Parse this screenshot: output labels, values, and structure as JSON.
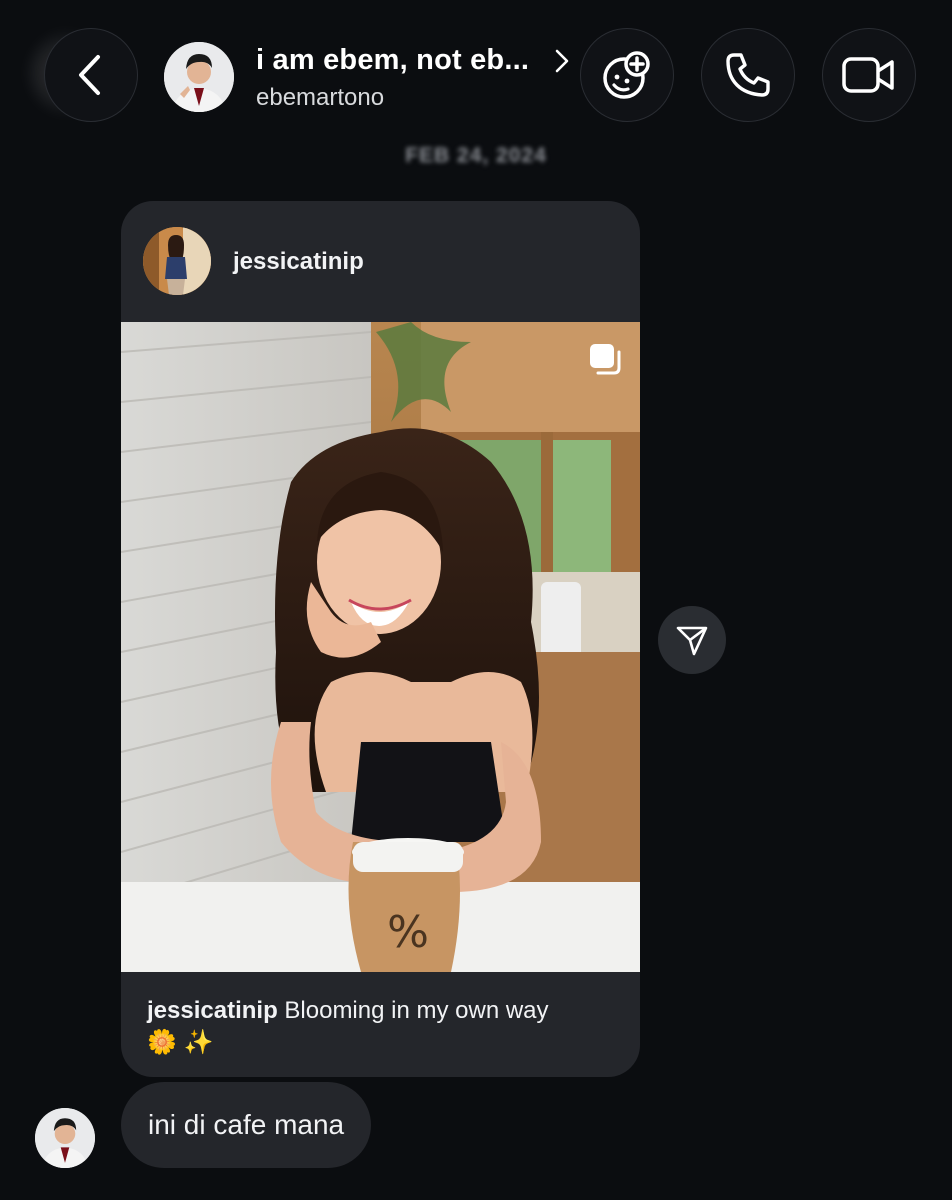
{
  "header": {
    "name": "i am ebem, not eb...",
    "username": "ebemartono"
  },
  "date_divider": "FEB 24, 2024",
  "shared_post": {
    "username": "jessicatinip",
    "caption_user": "jessicatinip",
    "caption_text": "Blooming in my own way",
    "caption_emoji": "🌼 ✨"
  },
  "message": {
    "text": "ini di cafe mana"
  },
  "icons": {
    "back": "chevron-left-icon",
    "chevron": "chevron-right-icon",
    "effects": "face-plus-icon",
    "call": "phone-icon",
    "video": "video-camera-icon",
    "multi": "carousel-icon",
    "share": "send-icon"
  },
  "colors": {
    "background": "#0b0d10",
    "bubble": "#24262b"
  }
}
